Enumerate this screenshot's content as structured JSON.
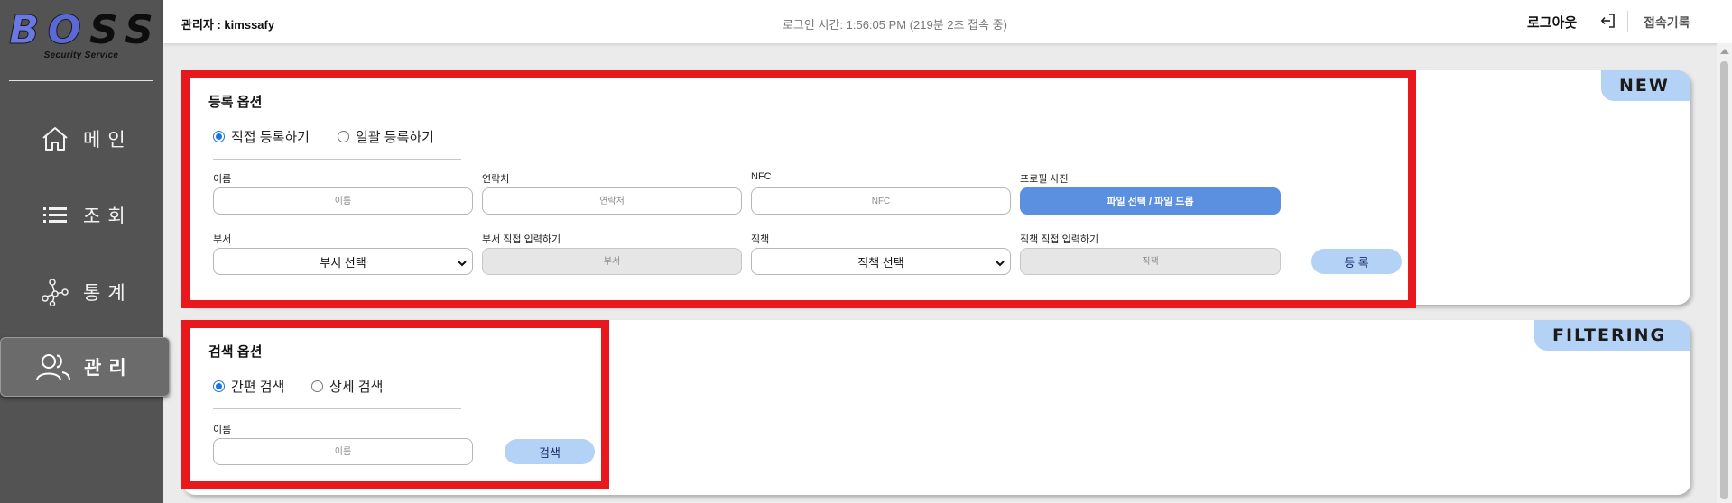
{
  "brand": {
    "letters": [
      "B",
      "O",
      "S",
      "S"
    ],
    "subtitle": "Security Service"
  },
  "sidebar": {
    "items": [
      {
        "label": "메인",
        "icon": "home-icon",
        "active": false
      },
      {
        "label": "조회",
        "icon": "list-icon",
        "active": false
      },
      {
        "label": "통계",
        "icon": "network-icon",
        "active": false
      },
      {
        "label": "관리",
        "icon": "users-icon",
        "active": true
      }
    ]
  },
  "header": {
    "admin": "관리자 : kimssafy",
    "login_time": "로그인 시간: 1:56:05 PM (219분 2초 접속 중)",
    "logout": "로그아웃",
    "history": "접속기록"
  },
  "register": {
    "badge": "NEW",
    "title": "등록 옵션",
    "options": [
      "직접 등록하기",
      "일괄 등록하기"
    ],
    "selected_option": "직접 등록하기",
    "fields": {
      "name": {
        "label": "이름",
        "placeholder": "이름"
      },
      "contact": {
        "label": "연락처",
        "placeholder": "연락처"
      },
      "nfc": {
        "label": "NFC",
        "placeholder": "NFC"
      },
      "photo": {
        "label": "프로필 사진",
        "button": "파일 선택 / 파일 드롭"
      },
      "dept": {
        "label": "부서",
        "value": "부서 선택"
      },
      "dept_direct": {
        "label": "부서 직접 입력하기",
        "placeholder": "부서"
      },
      "position": {
        "label": "직책",
        "value": "직책 선택"
      },
      "position_direct": {
        "label": "직책 직접 입력하기",
        "placeholder": "직책"
      }
    },
    "submit": "등 록"
  },
  "search": {
    "badge": "FILTERING",
    "title": "검색 옵션",
    "options": [
      "간편 검색",
      "상세 검색"
    ],
    "selected_option": "간편 검색",
    "name": {
      "label": "이름",
      "placeholder": "이름"
    },
    "submit": "검색"
  },
  "colors": {
    "sidebar_bg": "#535353",
    "highlight": "#e8181c",
    "badge_bg": "#b4d2f5",
    "primary_button": "#5b8fe0"
  }
}
